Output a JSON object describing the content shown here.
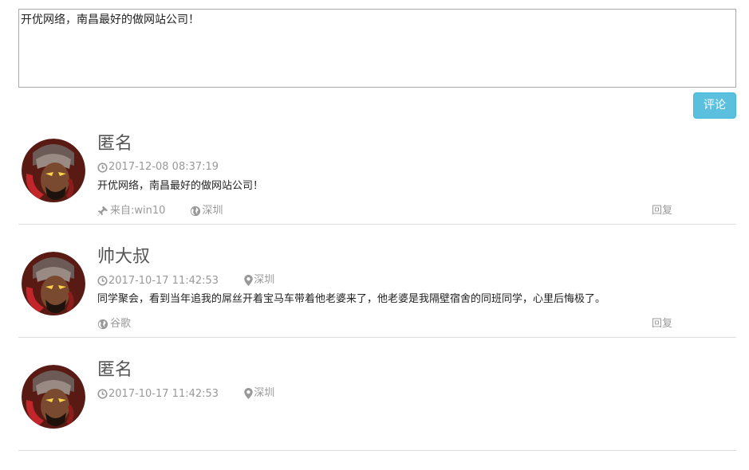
{
  "editor": {
    "value": "开优网络，南昌最好的做网站公司！"
  },
  "submit_label": "评论",
  "comments": [
    {
      "name": "匿名",
      "time": "2017-12-08 08:37:19",
      "location": "",
      "text": "开优网络，南昌最好的做网站公司！",
      "source": "来自:win10",
      "source_icon": "pin-icon",
      "place": "深圳",
      "reply": "回复"
    },
    {
      "name": "帅大叔",
      "time": "2017-10-17 11:42:53",
      "location": "深圳",
      "text": "同学聚会，看到当年追我的屌丝开着宝马车带着他老婆来了，他老婆是我隔壁宿舍的同班同学，心里后悔极了。",
      "source": "谷歌",
      "source_icon": "globe-icon",
      "place": "",
      "reply": "回复"
    },
    {
      "name": "匿名",
      "time": "2017-10-17 11:42:53",
      "location": "深圳",
      "text": "",
      "source": "",
      "place": "",
      "reply": ""
    }
  ],
  "colors": {
    "button": "#5bc0de",
    "muted": "#999999",
    "divider": "#dddddd"
  }
}
